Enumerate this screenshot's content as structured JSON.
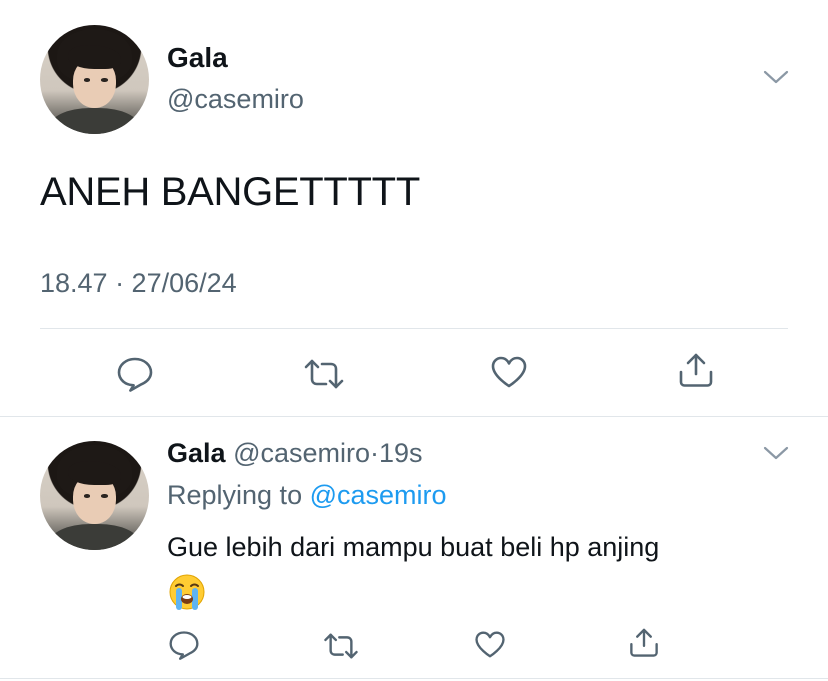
{
  "tweet": {
    "author_name": "Gala",
    "author_handle": "@casemiro",
    "text": "ANEH BANGETTTTT",
    "timestamp": "18.47 · 27/06/24",
    "actions": [
      "reply-icon",
      "retweet-icon",
      "like-icon",
      "share-icon"
    ]
  },
  "reply": {
    "author_name": "Gala",
    "author_handle": "@casemiro",
    "separator": "·",
    "age": "19s",
    "replying_prefix": "Replying to",
    "replying_handle": "@casemiro",
    "text": "Gue lebih dari mampu buat beli hp anjing",
    "emoji": "loudly-crying-face",
    "actions": [
      "reply-icon",
      "retweet-icon",
      "like-icon",
      "share-icon"
    ]
  },
  "colors": {
    "text": "#0f1419",
    "muted": "#536471",
    "link": "#1d9bf0",
    "divider": "#e1e6ea"
  }
}
